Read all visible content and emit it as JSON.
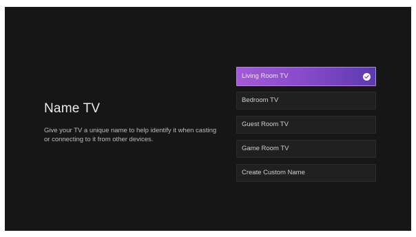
{
  "page": {
    "title": "Name TV",
    "description": "Give your TV a unique name to help identify it when casting or connecting to it from other devices."
  },
  "options": [
    {
      "label": "Living Room TV",
      "selected": true
    },
    {
      "label": "Bedroom TV",
      "selected": false
    },
    {
      "label": "Guest Room TV",
      "selected": false
    },
    {
      "label": "Game Room TV",
      "selected": false
    },
    {
      "label": "Create Custom Name",
      "selected": false
    }
  ],
  "icons": {
    "selected_indicator": "check-circle-icon"
  },
  "colors": {
    "background": "#161616",
    "accent_start": "#a45ad8",
    "accent_end": "#5b3ab0",
    "option_bg": "#202020",
    "text_primary": "#ececec",
    "text_secondary": "#bdbdbd"
  }
}
